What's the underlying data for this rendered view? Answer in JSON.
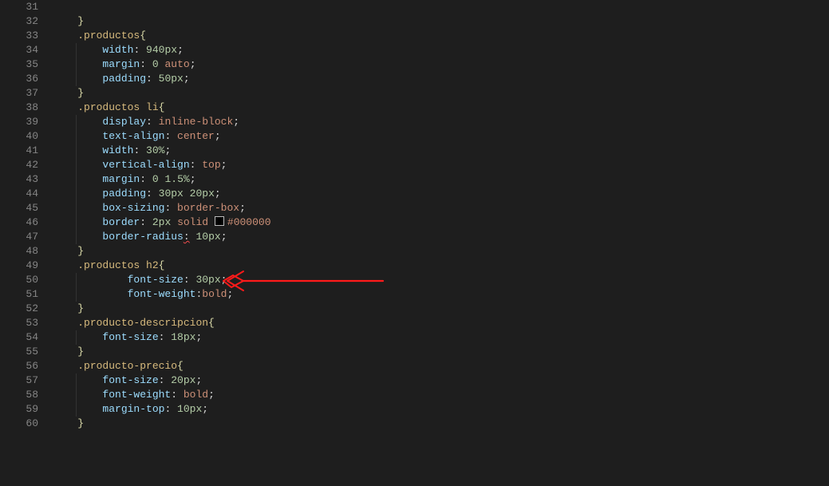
{
  "lines": [
    {
      "n": 31,
      "indent": 0,
      "guides": [],
      "tokens": []
    },
    {
      "n": 32,
      "indent": 1,
      "guides": [],
      "tokens": [
        {
          "t": "}",
          "c": "y"
        }
      ]
    },
    {
      "n": 33,
      "indent": 1,
      "guides": [],
      "tokens": [
        {
          "t": ".productos",
          "c": "sel"
        },
        {
          "t": "{",
          "c": "y"
        }
      ]
    },
    {
      "n": 34,
      "indent": 2,
      "guides": [
        2
      ],
      "tokens": [
        {
          "t": "width",
          "c": "prop"
        },
        {
          "t": ": ",
          "c": "pn"
        },
        {
          "t": "940px",
          "c": "num"
        },
        {
          "t": ";",
          "c": "pn"
        }
      ]
    },
    {
      "n": 35,
      "indent": 2,
      "guides": [
        2
      ],
      "tokens": [
        {
          "t": "margin",
          "c": "prop"
        },
        {
          "t": ": ",
          "c": "pn"
        },
        {
          "t": "0",
          "c": "num"
        },
        {
          "t": " ",
          "c": "pn"
        },
        {
          "t": "auto",
          "c": "val"
        },
        {
          "t": ";",
          "c": "pn"
        }
      ]
    },
    {
      "n": 36,
      "indent": 2,
      "guides": [
        2
      ],
      "tokens": [
        {
          "t": "padding",
          "c": "prop"
        },
        {
          "t": ": ",
          "c": "pn"
        },
        {
          "t": "50px",
          "c": "num"
        },
        {
          "t": ";",
          "c": "pn"
        }
      ]
    },
    {
      "n": 37,
      "indent": 1,
      "guides": [],
      "tokens": [
        {
          "t": "}",
          "c": "y"
        }
      ]
    },
    {
      "n": 38,
      "indent": 1,
      "guides": [],
      "tokens": [
        {
          "t": ".productos",
          "c": "sel"
        },
        {
          "t": " ",
          "c": "pn"
        },
        {
          "t": "li",
          "c": "sel"
        },
        {
          "t": "{",
          "c": "y"
        }
      ]
    },
    {
      "n": 39,
      "indent": 2,
      "guides": [
        2
      ],
      "tokens": [
        {
          "t": "display",
          "c": "prop"
        },
        {
          "t": ": ",
          "c": "pn"
        },
        {
          "t": "inline-block",
          "c": "val"
        },
        {
          "t": ";",
          "c": "pn"
        }
      ]
    },
    {
      "n": 40,
      "indent": 2,
      "guides": [
        2
      ],
      "tokens": [
        {
          "t": "text-align",
          "c": "prop"
        },
        {
          "t": ": ",
          "c": "pn"
        },
        {
          "t": "center",
          "c": "val"
        },
        {
          "t": ";",
          "c": "pn"
        }
      ]
    },
    {
      "n": 41,
      "indent": 2,
      "guides": [
        2
      ],
      "tokens": [
        {
          "t": "width",
          "c": "prop"
        },
        {
          "t": ": ",
          "c": "pn"
        },
        {
          "t": "30%",
          "c": "num"
        },
        {
          "t": ";",
          "c": "pn"
        }
      ]
    },
    {
      "n": 42,
      "indent": 2,
      "guides": [
        2
      ],
      "tokens": [
        {
          "t": "vertical-align",
          "c": "prop"
        },
        {
          "t": ": ",
          "c": "pn"
        },
        {
          "t": "top",
          "c": "val"
        },
        {
          "t": ";",
          "c": "pn"
        }
      ]
    },
    {
      "n": 43,
      "indent": 2,
      "guides": [
        2
      ],
      "tokens": [
        {
          "t": "margin",
          "c": "prop"
        },
        {
          "t": ": ",
          "c": "pn"
        },
        {
          "t": "0",
          "c": "num"
        },
        {
          "t": " ",
          "c": "pn"
        },
        {
          "t": "1.5%",
          "c": "num"
        },
        {
          "t": ";",
          "c": "pn"
        }
      ]
    },
    {
      "n": 44,
      "indent": 2,
      "guides": [
        2
      ],
      "tokens": [
        {
          "t": "padding",
          "c": "prop"
        },
        {
          "t": ": ",
          "c": "pn"
        },
        {
          "t": "30px",
          "c": "num"
        },
        {
          "t": " ",
          "c": "pn"
        },
        {
          "t": "20px",
          "c": "num"
        },
        {
          "t": ";",
          "c": "pn"
        }
      ]
    },
    {
      "n": 45,
      "indent": 2,
      "guides": [
        2
      ],
      "tokens": [
        {
          "t": "box-sizing",
          "c": "prop"
        },
        {
          "t": ": ",
          "c": "pn"
        },
        {
          "t": "border-box",
          "c": "val"
        },
        {
          "t": ";",
          "c": "pn"
        }
      ]
    },
    {
      "n": 46,
      "indent": 2,
      "guides": [
        2
      ],
      "tokens": [
        {
          "t": "border",
          "c": "prop"
        },
        {
          "t": ": ",
          "c": "pn"
        },
        {
          "t": "2px",
          "c": "num"
        },
        {
          "t": " ",
          "c": "pn"
        },
        {
          "t": "solid",
          "c": "val"
        },
        {
          "t": " ",
          "c": "pn"
        },
        {
          "swatch": true
        },
        {
          "t": "#000000",
          "c": "val"
        }
      ]
    },
    {
      "n": 47,
      "indent": 2,
      "guides": [
        2
      ],
      "tokens": [
        {
          "t": "border-radius",
          "c": "prop"
        },
        {
          "t": ":",
          "c": "pn",
          "squiggle": true
        },
        {
          "t": " ",
          "c": "pn"
        },
        {
          "t": "10px",
          "c": "num"
        },
        {
          "t": ";",
          "c": "pn"
        }
      ]
    },
    {
      "n": 48,
      "indent": 1,
      "guides": [],
      "tokens": [
        {
          "t": "}",
          "c": "y"
        }
      ]
    },
    {
      "n": 49,
      "indent": 1,
      "guides": [],
      "tokens": [
        {
          "t": ".productos",
          "c": "sel"
        },
        {
          "t": " ",
          "c": "pn"
        },
        {
          "t": "h2",
          "c": "sel"
        },
        {
          "t": "{",
          "c": "y"
        }
      ]
    },
    {
      "n": 50,
      "indent": 3,
      "guides": [
        2
      ],
      "tokens": [
        {
          "t": "font-size",
          "c": "prop"
        },
        {
          "t": ": ",
          "c": "pn"
        },
        {
          "t": "30px",
          "c": "num"
        },
        {
          "t": ";",
          "c": "pn"
        }
      ]
    },
    {
      "n": 51,
      "indent": 3,
      "guides": [
        2
      ],
      "tokens": [
        {
          "t": "font-weight",
          "c": "prop"
        },
        {
          "t": ":",
          "c": "pn"
        },
        {
          "t": "bold",
          "c": "val"
        },
        {
          "t": ";",
          "c": "pn"
        }
      ]
    },
    {
      "n": 52,
      "indent": 1,
      "guides": [],
      "tokens": [
        {
          "t": "}",
          "c": "y"
        }
      ]
    },
    {
      "n": 53,
      "indent": 1,
      "guides": [],
      "tokens": [
        {
          "t": ".producto-descripcion",
          "c": "sel"
        },
        {
          "t": "{",
          "c": "y"
        }
      ]
    },
    {
      "n": 54,
      "indent": 2,
      "guides": [
        2
      ],
      "tokens": [
        {
          "t": "font-size",
          "c": "prop"
        },
        {
          "t": ": ",
          "c": "pn"
        },
        {
          "t": "18px",
          "c": "num"
        },
        {
          "t": ";",
          "c": "pn"
        }
      ]
    },
    {
      "n": 55,
      "indent": 1,
      "guides": [],
      "tokens": [
        {
          "t": "}",
          "c": "y"
        }
      ]
    },
    {
      "n": 56,
      "indent": 1,
      "guides": [],
      "tokens": [
        {
          "t": ".producto-precio",
          "c": "sel"
        },
        {
          "t": "{",
          "c": "y"
        }
      ]
    },
    {
      "n": 57,
      "indent": 2,
      "guides": [
        2
      ],
      "tokens": [
        {
          "t": "font-size",
          "c": "prop"
        },
        {
          "t": ": ",
          "c": "pn"
        },
        {
          "t": "20px",
          "c": "num"
        },
        {
          "t": ";",
          "c": "pn"
        }
      ]
    },
    {
      "n": 58,
      "indent": 2,
      "guides": [
        2
      ],
      "tokens": [
        {
          "t": "font-weight",
          "c": "prop"
        },
        {
          "t": ": ",
          "c": "pn"
        },
        {
          "t": "bold",
          "c": "val"
        },
        {
          "t": ";",
          "c": "pn"
        }
      ]
    },
    {
      "n": 59,
      "indent": 2,
      "guides": [
        2
      ],
      "tokens": [
        {
          "t": "margin-top",
          "c": "prop"
        },
        {
          "t": ": ",
          "c": "pn"
        },
        {
          "t": "10px",
          "c": "num"
        },
        {
          "t": ";",
          "c": "pn"
        }
      ]
    },
    {
      "n": 60,
      "indent": 1,
      "guides": [],
      "tokens": [
        {
          "t": "}",
          "c": "y"
        }
      ]
    }
  ],
  "annotation": {
    "arrow_color": "#ff1a1a",
    "target_line": 48
  }
}
